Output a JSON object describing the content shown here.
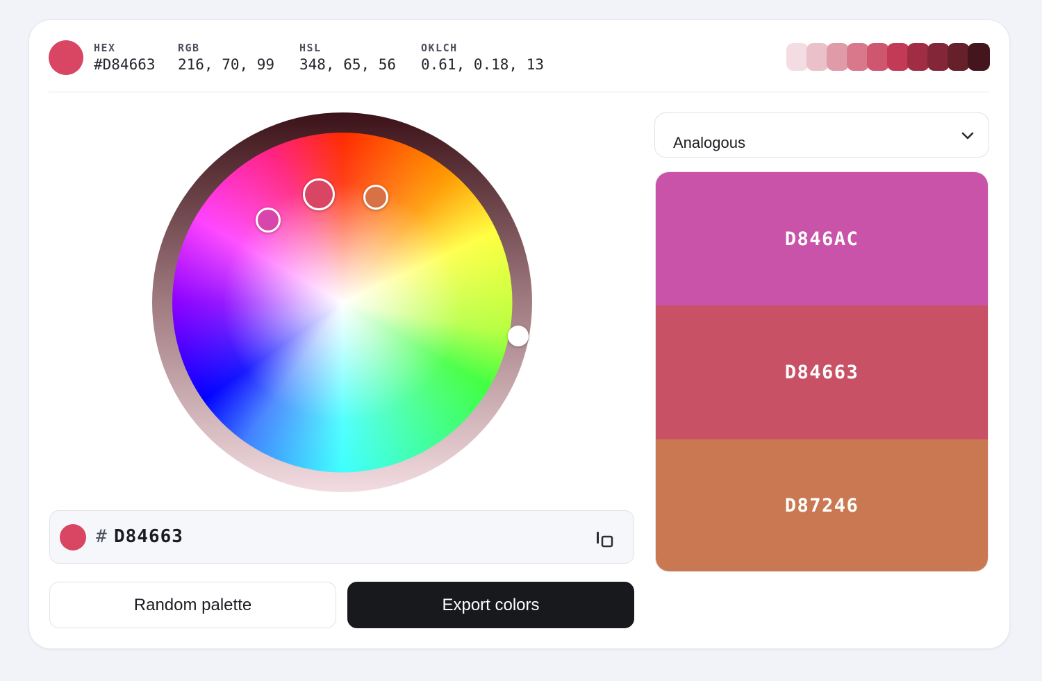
{
  "current": {
    "color": "#D84663",
    "hex_label": "HEX",
    "hex_value": "#D84663",
    "rgb_label": "RGB",
    "rgb_value": "216, 70, 99",
    "hsl_label": "HSL",
    "hsl_value": "348, 65, 56",
    "oklch_label": "OKLCH",
    "oklch_value": "0.61, 0.18, 13"
  },
  "shades": [
    "#f3dde2",
    "#eac0c9",
    "#e09ba9",
    "#d9788b",
    "#cf566f",
    "#c23a55",
    "#a12d45",
    "#832738",
    "#652029",
    "#44151c"
  ],
  "wheel": {
    "selected_color": "#D84663",
    "harmony_colors": [
      "#D846AC",
      "#D84663",
      "#D87246"
    ]
  },
  "input": {
    "hash": "#",
    "hex": "D84663",
    "copy_icon": "copy-icon"
  },
  "buttons": {
    "random": "Random palette",
    "export": "Export colors"
  },
  "harmony": {
    "selected": "Analogous",
    "chevron_icon": "chevron-down-icon"
  },
  "palette": [
    {
      "hex": "D846AC",
      "color": "#C853A8"
    },
    {
      "hex": "D84663",
      "color": "#C85165"
    },
    {
      "hex": "D87246",
      "color": "#C97851"
    }
  ]
}
